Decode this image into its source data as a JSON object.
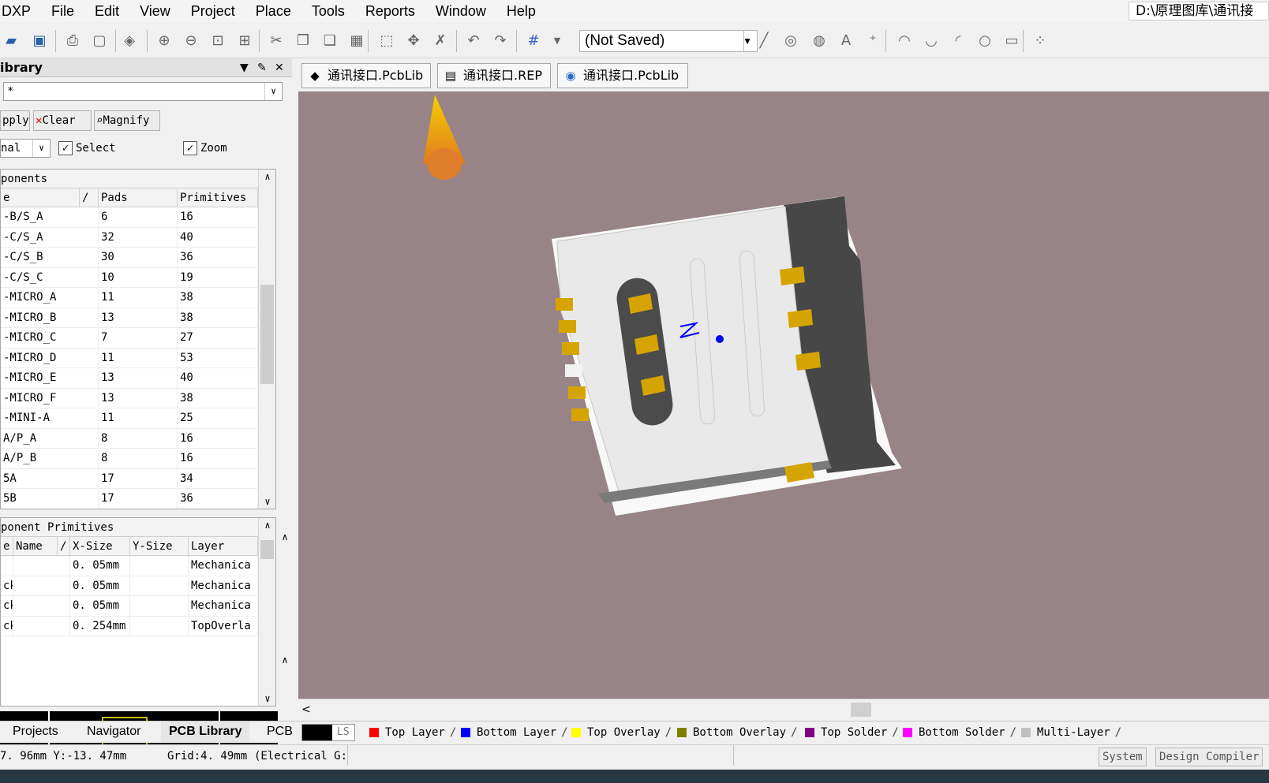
{
  "menubar": {
    "items": [
      "DXP",
      "File",
      "Edit",
      "View",
      "Project",
      "Place",
      "Tools",
      "Reports",
      "Window",
      "Help"
    ],
    "path": "D:\\原理图库\\通讯接"
  },
  "toolbar": {
    "view_select": "(Not Saved)",
    "icons": [
      "open-icon",
      "save-icon",
      "print-icon",
      "print-preview-icon",
      "layer-stack-icon",
      "zoom-in-icon",
      "zoom-out-icon",
      "zoom-fit-icon",
      "zoom-selection-icon",
      "cut-icon",
      "copy-icon",
      "paste-icon",
      "rubber-stamp-icon",
      "select-area-icon",
      "move-icon",
      "deselect-icon",
      "undo-icon",
      "redo-icon",
      "grid-icon",
      "line-icon",
      "pad-icon",
      "via-icon",
      "string-icon",
      "coordinate-icon",
      "arc-center-icon",
      "arc-edge-icon",
      "arc-any-icon",
      "circle-icon",
      "fill-icon",
      "array-paste-icon"
    ]
  },
  "panel": {
    "title": "ibrary",
    "mask": "*",
    "buttons": {
      "apply": "pply",
      "clear": "Clear",
      "magnify": "Magnify"
    },
    "mode": "nal",
    "select_label": "Select",
    "zoom_label": "Zoom",
    "components": {
      "caption": "ponents",
      "headers": [
        "e",
        "/",
        "Pads",
        "Primitives"
      ],
      "rows": [
        [
          "-B/S_A",
          "6",
          "16"
        ],
        [
          "-C/S_A",
          "32",
          "40"
        ],
        [
          "-C/S_B",
          "30",
          "36"
        ],
        [
          "-C/S_C",
          "10",
          "19"
        ],
        [
          "-MICRO_A",
          "11",
          "38"
        ],
        [
          "-MICRO_B",
          "13",
          "38"
        ],
        [
          "-MICRO_C",
          "7",
          "27"
        ],
        [
          "-MICRO_D",
          "11",
          "53"
        ],
        [
          "-MICRO_E",
          "13",
          "40"
        ],
        [
          "-MICRO_F",
          "13",
          "38"
        ],
        [
          "-MINI-A",
          "11",
          "25"
        ],
        "A/P_A,8,16",
        "A/P_B,8,16",
        "5A,17,34",
        "5B,17,36"
      ],
      "scroll_fraction": 0.32
    },
    "primitives": {
      "caption": "ponent Primitives",
      "headers": [
        "e",
        "Name",
        "/",
        "X-Size",
        "Y-Size",
        "Layer"
      ],
      "rows": [
        [
          "",
          "",
          "0. 05mm",
          "",
          "Mechanica"
        ],
        [
          "ck",
          "",
          "0. 05mm",
          "",
          "Mechanica"
        ],
        [
          "ck",
          "",
          "0. 05mm",
          "",
          "Mechanica"
        ],
        [
          "ck",
          "",
          "0. 254mm",
          "",
          "TopOverla"
        ]
      ]
    },
    "tabs": [
      "Projects",
      "Navigator",
      "PCB Library",
      "PCB"
    ]
  },
  "documents": {
    "tabs": [
      "通讯接口.PcbLib",
      "通讯接口.REP",
      "通讯接口.PcbLib"
    ]
  },
  "layers": {
    "ls": "LS",
    "items": [
      {
        "name": "Top Layer",
        "color": "#ff0000"
      },
      {
        "name": "Bottom Layer",
        "color": "#0000ff"
      },
      {
        "name": "Top Overlay",
        "color": "#ffff00"
      },
      {
        "name": "Bottom Overlay",
        "color": "#808000"
      },
      {
        "name": "Top Solder",
        "color": "#800080"
      },
      {
        "name": "Bottom Solder",
        "color": "#ff00ff"
      },
      {
        "name": "Multi-Layer",
        "color": "#c0c0c0"
      }
    ]
  },
  "status": {
    "coords": "7. 96mm Y:-13. 47mm",
    "grid": "Grid:4. 49mm",
    "hotspot": "(Electrical G:",
    "buttons": [
      "System",
      "Design Compiler"
    ]
  },
  "colors": {
    "viewport_bg": "#988486",
    "component_body": "#e8e8e8",
    "housing": "#4a4a4a",
    "pins": "#d8a600",
    "origin_marker": "#0000ff"
  }
}
